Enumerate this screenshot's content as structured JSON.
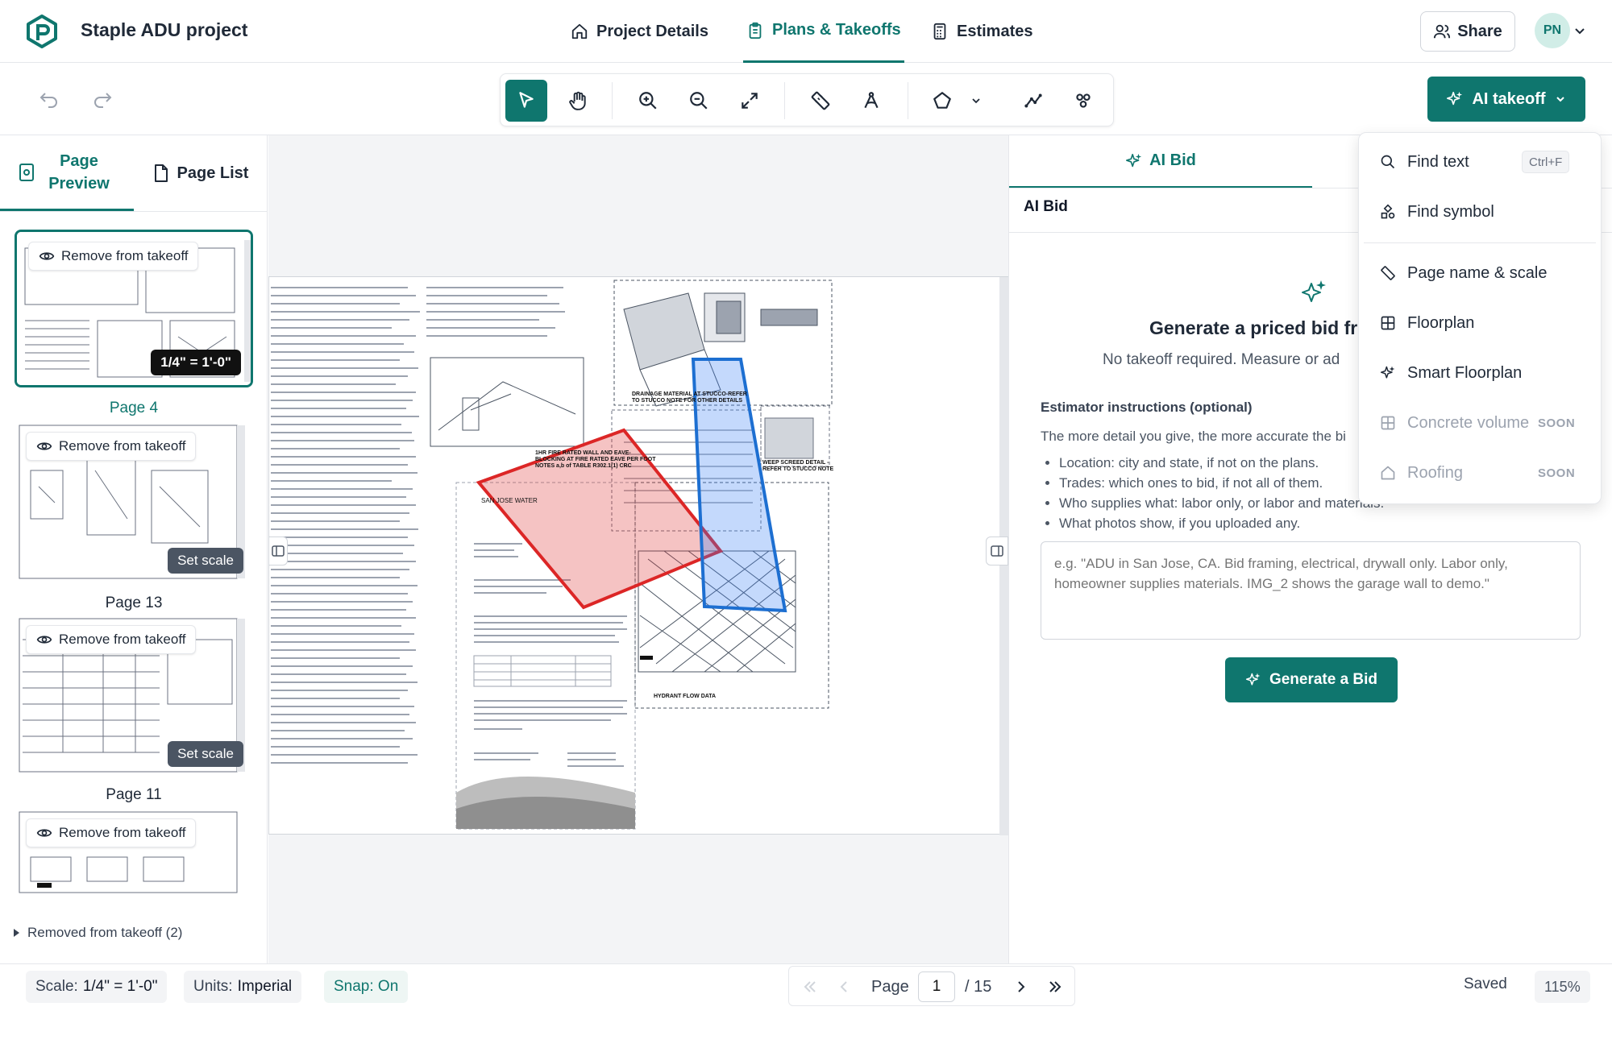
{
  "header": {
    "project_title": "Staple ADU project",
    "tabs": [
      {
        "label": "Project Details",
        "icon": "home-icon"
      },
      {
        "label": "Plans & Takeoffs",
        "icon": "clipboard-icon",
        "active": true
      },
      {
        "label": "Estimates",
        "icon": "calculator-icon"
      }
    ],
    "share_label": "Share",
    "avatar_initials": "PN"
  },
  "toolbar": {
    "tools": [
      "select-pointer-icon",
      "hand-pan-icon",
      "zoom-in-icon",
      "zoom-out-icon",
      "fit-screen-icon",
      "ruler-icon",
      "angle-measure-icon",
      "polygon-icon",
      "chevron-down-icon",
      "polyline-icon",
      "count-icon"
    ],
    "ai_takeoff_label": "AI takeoff"
  },
  "left_panel": {
    "tabs": [
      {
        "label": "Page Preview",
        "active": true
      },
      {
        "label": "Page List"
      }
    ],
    "pages": [
      {
        "remove_label": "Remove from takeoff",
        "scale": "1/4\" = 1'-0\"",
        "label": "Page 4"
      },
      {
        "remove_label": "Remove from takeoff",
        "set_scale": "Set scale",
        "label": "Page 13"
      },
      {
        "remove_label": "Remove from takeoff",
        "set_scale": "Set scale",
        "label": "Page 11"
      },
      {
        "remove_label": "Remove from takeoff"
      }
    ],
    "removed_toggle": "Removed from takeoff (2)"
  },
  "canvas": {
    "sheet_texts": {
      "fire_wall_note": "1HR FIRE RATED WALL AND EAVE-BLOCKING AT FIRE RATED EAVE PER FOOT NOTES a,b of TABLE R302.1(1) CRC",
      "drainage_note": "DRAINAGE MATERIAL AT STUCCO-REFER TO STUCCO NOTE FOR OTHER DETAILS",
      "weep_screed": "WEEP SCREED DETAIL - REFER TO STUCCO NOTE",
      "letter_head": "SAN JOSE WATER",
      "hydrant_title": "HYDRANT FLOW DATA"
    }
  },
  "right_panel": {
    "tab_label": "AI Bid",
    "header": "AI Bid",
    "title": "Generate a priced bid fro",
    "subtitle": "No takeoff required. Measure or ad",
    "instructions_label": "Estimator instructions (optional)",
    "instructions_desc": "The more detail you give, the more accurate the bi",
    "bullets": [
      "Location: city and state, if not on the plans.",
      "Trades: which ones to bid, if not all of them.",
      "Who supplies what: labor only, or labor and materials.",
      "What photos show, if you uploaded any."
    ],
    "placeholder": "e.g. \"ADU in San Jose, CA. Bid framing, electrical, drywall only. Labor only, homeowner supplies materials. IMG_2 shows the garage wall to demo.\"",
    "generate_label": "Generate a Bid"
  },
  "dropdown": {
    "items": [
      {
        "label": "Find text",
        "icon": "search-icon",
        "shortcut": "Ctrl+F"
      },
      {
        "label": "Find symbol",
        "icon": "symbol-icon"
      },
      {
        "label": "Page name & scale",
        "icon": "ruler-icon"
      },
      {
        "label": "Floorplan",
        "icon": "grid-icon"
      },
      {
        "label": "Smart Floorplan",
        "icon": "sparkle-icon"
      },
      {
        "label": "Concrete volume",
        "icon": "grid-icon",
        "badge": "SOON",
        "disabled": true
      },
      {
        "label": "Roofing",
        "icon": "home-icon",
        "badge": "SOON",
        "disabled": true
      }
    ]
  },
  "status": {
    "scale_label": "Scale:",
    "scale_value": "1/4\" = 1'-0\"",
    "units_label": "Units:",
    "units_value": "Imperial",
    "snap": "Snap: On",
    "page_label": "Page",
    "page_current": "1",
    "page_total": "/ 15",
    "saved": "Saved",
    "zoom": "115%"
  },
  "colors": {
    "accent": "#0f766e",
    "red_polygon": "#dc2626",
    "blue_polygon": "#1d6fd1"
  }
}
